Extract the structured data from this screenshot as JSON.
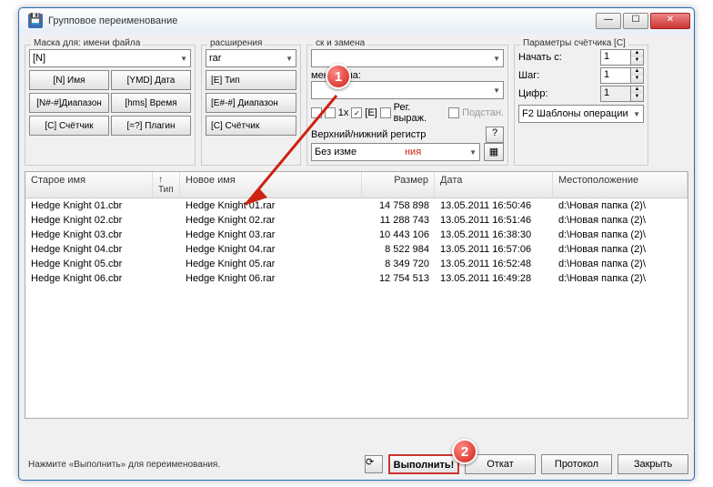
{
  "window": {
    "title": "Групповое переименование"
  },
  "mask": {
    "label": "Маска для: имени файла",
    "value": "[N]",
    "buttons": [
      "[N]   Имя",
      "[YMD] Дата",
      "[N#-#]Диапазон",
      "[hms]  Время",
      "[C]    Счётчик",
      "[=?]  Плагин"
    ]
  },
  "ext": {
    "label": "расширения",
    "value": "rar",
    "buttons": [
      "[E]    Тип",
      "[E#-#] Диапазон",
      "[C]    Счётчик"
    ]
  },
  "search": {
    "label": "ск и замена",
    "find": "",
    "replace_label": "менить на:",
    "replace": "",
    "opt_1x": "1x",
    "opt_e": "[E]",
    "opt_regex": "Рег. выраж.",
    "opt_sub": "Подстан.",
    "case_label": "Верхний/нижний регистр",
    "case_value": "Без изме"
  },
  "counter": {
    "label": "Параметры счётчика [C]",
    "start_label": "Начать с:",
    "start": "1",
    "step_label": "Шаг:",
    "step": "1",
    "digits_label": "Цифр:",
    "digits": "1"
  },
  "templates_label": "F2 Шаблоны операции",
  "table": {
    "headers": {
      "old": "Старое имя",
      "tip": "↑ Тип",
      "new": "Новое имя",
      "size": "Размер",
      "date": "Дата",
      "loc": "Местоположение"
    },
    "rows": [
      {
        "old": "Hedge Knight 01.cbr",
        "new": "Hedge Knight 01.rar",
        "size": "14 758 898",
        "date": "13.05.2011 16:50:46",
        "loc": "d:\\Новая папка (2)\\"
      },
      {
        "old": "Hedge Knight 02.cbr",
        "new": "Hedge Knight 02.rar",
        "size": "11 288 743",
        "date": "13.05.2011 16:51:46",
        "loc": "d:\\Новая папка (2)\\"
      },
      {
        "old": "Hedge Knight 03.cbr",
        "new": "Hedge Knight 03.rar",
        "size": "10 443 106",
        "date": "13.05.2011 16:38:30",
        "loc": "d:\\Новая папка (2)\\"
      },
      {
        "old": "Hedge Knight 04.cbr",
        "new": "Hedge Knight 04.rar",
        "size": "8 522 984",
        "date": "13.05.2011 16:57:06",
        "loc": "d:\\Новая папка (2)\\"
      },
      {
        "old": "Hedge Knight 05.cbr",
        "new": "Hedge Knight 05.rar",
        "size": "8 349 720",
        "date": "13.05.2011 16:52:48",
        "loc": "d:\\Новая папка (2)\\"
      },
      {
        "old": "Hedge Knight 06.cbr",
        "new": "Hedge Knight 06.rar",
        "size": "12 754 513",
        "date": "13.05.2011 16:49:28",
        "loc": "d:\\Новая папка (2)\\"
      }
    ]
  },
  "footer": {
    "hint": "Нажмите «Выполнить» для переименования.",
    "exec": "Выполнить!",
    "undo": "Откат",
    "log": "Протокол",
    "close": "Закрыть"
  },
  "markers": {
    "m1": "1",
    "m2": "2"
  }
}
